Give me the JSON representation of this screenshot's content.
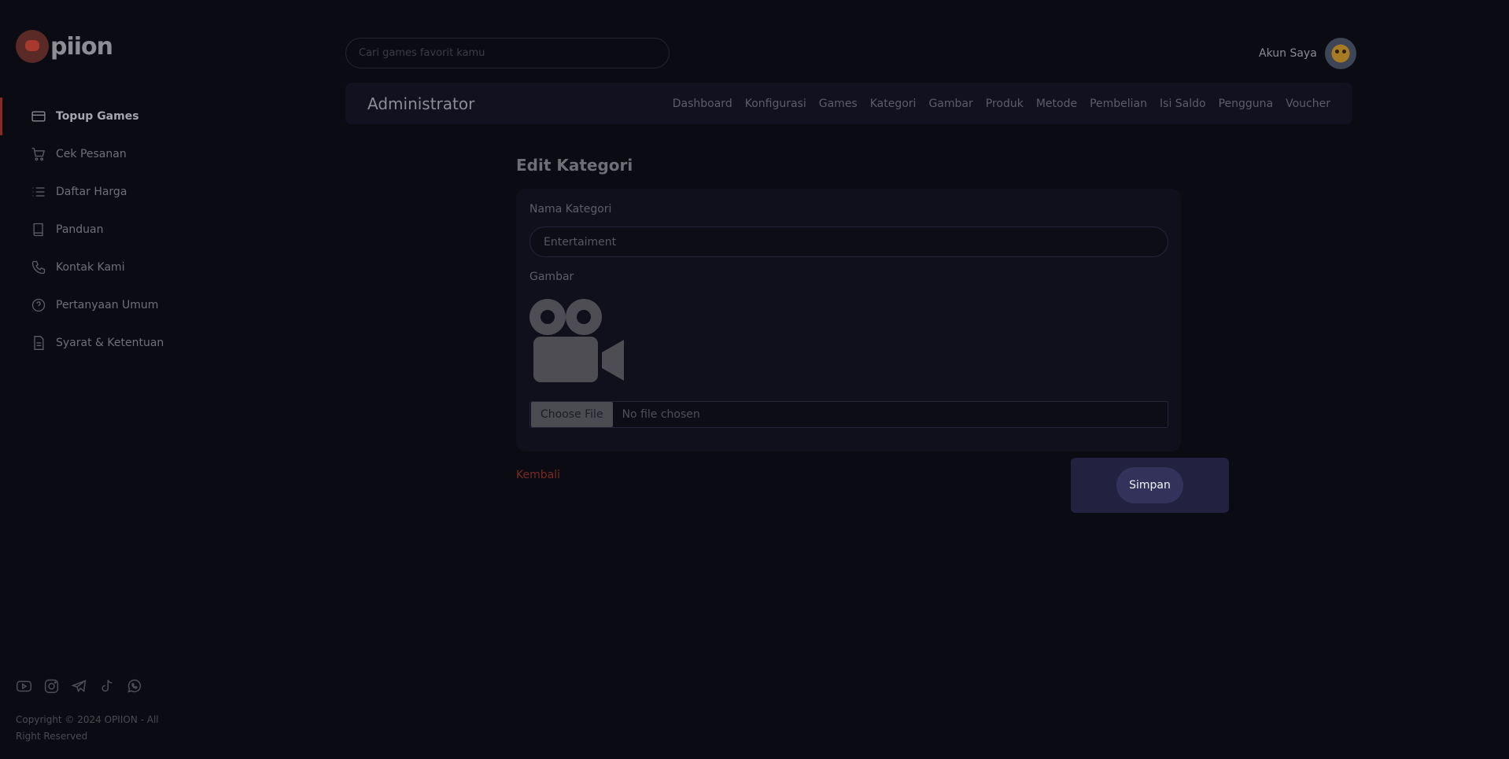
{
  "brand": {
    "logo_text": "piion"
  },
  "sidebar": {
    "items": [
      {
        "label": "Topup Games",
        "icon": "credit-card-icon",
        "active": true
      },
      {
        "label": "Cek Pesanan",
        "icon": "cart-icon"
      },
      {
        "label": "Daftar Harga",
        "icon": "list-icon"
      },
      {
        "label": "Panduan",
        "icon": "book-icon"
      },
      {
        "label": "Kontak Kami",
        "icon": "phone-icon"
      },
      {
        "label": "Pertanyaan Umum",
        "icon": "question-icon"
      },
      {
        "label": "Syarat & Ketentuan",
        "icon": "document-icon"
      }
    ],
    "socials": [
      "youtube-icon",
      "instagram-icon",
      "telegram-icon",
      "tiktok-icon",
      "whatsapp-icon"
    ],
    "copyright": "Copyright © 2024 OPIION - All Right Reserved"
  },
  "header": {
    "search_placeholder": "Cari games favorit kamu",
    "account_label": "Akun Saya"
  },
  "admin_bar": {
    "title": "Administrator",
    "menu": [
      "Dashboard",
      "Konfigurasi",
      "Games",
      "Kategori",
      "Gambar",
      "Produk",
      "Metode",
      "Pembelian",
      "Isi Saldo",
      "Pengguna",
      "Voucher"
    ]
  },
  "form": {
    "title": "Edit Kategori",
    "name_label": "Nama Kategori",
    "name_value": "Entertaiment",
    "image_label": "Gambar",
    "image_icon": "video-camera-icon",
    "file_button": "Choose File",
    "file_status": "No file chosen",
    "back_label": "Kembali",
    "save_label": "Simpan"
  },
  "colors": {
    "background": "#0b0b14",
    "accent_red": "#8a2a22",
    "save_button": "#33325a"
  }
}
